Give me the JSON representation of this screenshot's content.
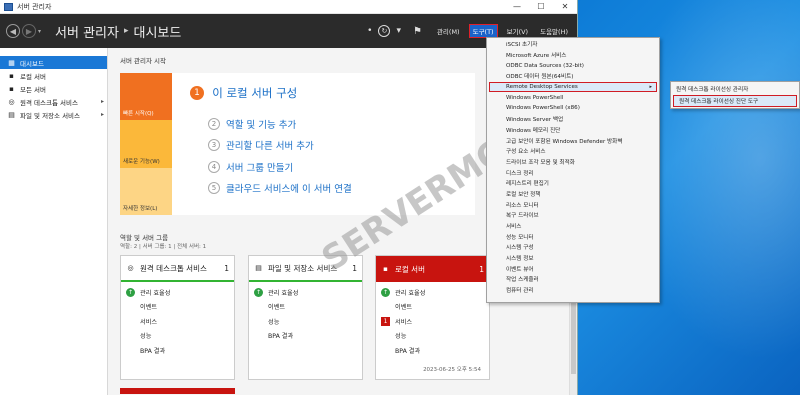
{
  "window": {
    "title": "서버 관리자",
    "controls": [
      "—",
      "☐",
      "✕"
    ]
  },
  "header": {
    "breadcrumb_app": "서버 관리자",
    "breadcrumb_sep": "▸",
    "breadcrumb_page": "대시보드",
    "menus": [
      "관리(M)",
      "도구(T)",
      "보기(V)",
      "도움말(H)"
    ]
  },
  "sidebar": {
    "items": [
      {
        "label": "대시보드",
        "icon": "grid-icon",
        "glyph": "▦"
      },
      {
        "label": "로컬 서버",
        "icon": "server-icon",
        "glyph": "▪"
      },
      {
        "label": "모든 서버",
        "icon": "servers-icon",
        "glyph": "▪"
      },
      {
        "label": "원격 데스크톱 서비스",
        "icon": "remote-desktop-icon",
        "glyph": "◎"
      },
      {
        "label": "파일 및 저장소 서비스",
        "icon": "file-storage-icon",
        "glyph": "▤"
      }
    ]
  },
  "main": {
    "section_title": "서버 관리자 시작",
    "tiles": [
      "빠른 시작(Q)",
      "새로운 기능(W)",
      "자세한 정보(L)"
    ],
    "headline_num": "1",
    "headline": "이 로컬 서버 구성",
    "steps": [
      {
        "num": "2",
        "text": "역할 및 기능 추가"
      },
      {
        "num": "3",
        "text": "관리할 다른 서버 추가"
      },
      {
        "num": "4",
        "text": "서버 그룹 만들기"
      },
      {
        "num": "5",
        "text": "클라우드 서비스에 이 서버 연결"
      }
    ],
    "roles_title": "역할 및 서버 그룹",
    "roles_sub": "역할: 2  |  서버 그룹: 1  |  전체 서버: 1",
    "cards": [
      {
        "title": "원격 데스크톱 서비스",
        "count": "1",
        "icon": "remote-desktop-icon",
        "glyph": "◎",
        "alert": false,
        "rows": [
          {
            "badge": "ok",
            "badge_text": "↑",
            "label": "관리 효율성"
          },
          {
            "badge": "empty",
            "badge_text": "",
            "label": "이벤트"
          },
          {
            "badge": "empty",
            "badge_text": "",
            "label": "서비스"
          },
          {
            "badge": "empty",
            "badge_text": "",
            "label": "성능"
          },
          {
            "badge": "empty",
            "badge_text": "",
            "label": "BPA 결과"
          }
        ]
      },
      {
        "title": "파일 및 저장소 서비스",
        "count": "1",
        "icon": "file-storage-icon",
        "glyph": "▤",
        "alert": false,
        "rows": [
          {
            "badge": "ok",
            "badge_text": "↑",
            "label": "관리 효율성"
          },
          {
            "badge": "empty",
            "badge_text": "",
            "label": "이벤트"
          },
          {
            "badge": "empty",
            "badge_text": "",
            "label": "성능"
          },
          {
            "badge": "empty",
            "badge_text": "",
            "label": "BPA 결과"
          }
        ]
      },
      {
        "title": "로컬 서버",
        "count": "1",
        "icon": "server-icon",
        "glyph": "▪",
        "alert": true,
        "rows": [
          {
            "badge": "ok",
            "badge_text": "↑",
            "label": "관리 효율성"
          },
          {
            "badge": "empty",
            "badge_text": "",
            "label": "이벤트"
          },
          {
            "badge": "red",
            "badge_text": "1",
            "label": "서비스"
          },
          {
            "badge": "empty",
            "badge_text": "",
            "label": "성능"
          },
          {
            "badge": "empty",
            "badge_text": "",
            "label": "BPA 결과"
          }
        ],
        "timestamp": "2023-06-25 오후 5:54"
      }
    ]
  },
  "tools_menu": {
    "items": [
      "iSCSI 초기자",
      "Microsoft Azure 서비스",
      "ODBC Data Sources (32-bit)",
      "ODBC 데이터 원본(64비트)",
      "Remote Desktop Services",
      "Windows PowerShell",
      "Windows PowerShell (x86)",
      "Windows Server 백업",
      "Windows 메모리 진단",
      "고급 보안이 포함된 Windows Defender 방화벽",
      "구성 요소 서비스",
      "드라이브 조각 모음 및 최적화",
      "디스크 정리",
      "레지스트리 편집기",
      "로컬 보안 정책",
      "리소스 모니터",
      "복구 드라이브",
      "서비스",
      "성능 모니터",
      "시스템 구성",
      "시스템 정보",
      "이벤트 뷰어",
      "작업 스케줄러",
      "컴퓨터 관리"
    ],
    "highlighted_index": 4,
    "submenu_arrow": "▸"
  },
  "rds_submenu": {
    "items": [
      "원격 데스크톱 라이선싱 관리자",
      "원격 데스크톱 라이선싱 진단 도구"
    ],
    "highlighted_index": 1
  },
  "watermark": {
    "text": "SERVERMON"
  },
  "colors": {
    "accent": "#1a78d6",
    "header_bg": "#2b2b2b",
    "quick_start": "#f07020",
    "alert": "#c8140f",
    "ok": "#2ea043",
    "highlight_border": "#d01c24"
  }
}
